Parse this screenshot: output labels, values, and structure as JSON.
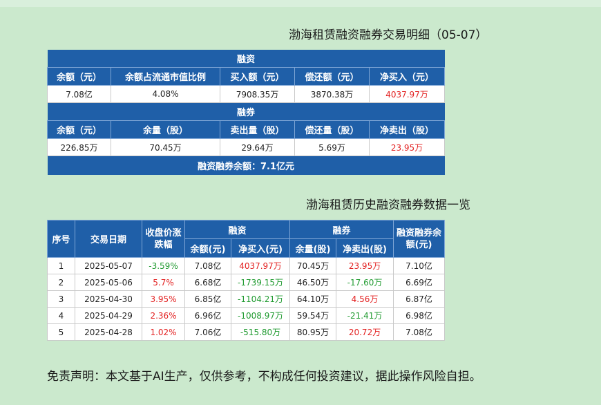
{
  "colors": {
    "header_bg": "#1f5fa8",
    "page_bg": "#cbe9cd",
    "positive": "#e32222",
    "negative": "#1f9a2f"
  },
  "title1": "渤海租赁融资融券交易明细（05-07）",
  "summary": {
    "margin_section": "融资",
    "margin_headers": [
      "余额（元）",
      "余额占流通市值比例",
      "买入额（元）",
      "偿还额（元）",
      "净买入（元）"
    ],
    "margin_values": [
      "7.08亿",
      "4.08%",
      "7908.35万",
      "3870.38万",
      "4037.97万"
    ],
    "short_section": "融券",
    "short_headers": [
      "余额（元）",
      "余量（股）",
      "卖出量（股）",
      "偿还量（股）",
      "净卖出（股）"
    ],
    "short_values": [
      "226.85万",
      "70.45万",
      "29.64万",
      "5.69万",
      "23.95万"
    ],
    "total": "融资融券余额：7.1亿元"
  },
  "title2": "渤海租赁历史融资融券数据一览",
  "history": {
    "headers": {
      "seq": "序号",
      "date": "交易日期",
      "change": "收盘价涨跌幅",
      "margin": "融资",
      "short": "融券",
      "total": "融资融券余额(元)",
      "margin_balance": "余额(元)",
      "net_buy": "净买入(元)",
      "short_volume": "余量(股)",
      "net_sell": "净卖出(股)"
    },
    "rows": [
      {
        "seq": "1",
        "date": "2025-05-07",
        "change": "-3.59%",
        "margin_balance": "7.08亿",
        "net_buy": "4037.97万",
        "short_volume": "70.45万",
        "net_sell": "23.95万",
        "total": "7.10亿"
      },
      {
        "seq": "2",
        "date": "2025-05-06",
        "change": "5.7%",
        "margin_balance": "6.68亿",
        "net_buy": "-1739.15万",
        "short_volume": "46.50万",
        "net_sell": "-17.60万",
        "total": "6.69亿"
      },
      {
        "seq": "3",
        "date": "2025-04-30",
        "change": "3.95%",
        "margin_balance": "6.85亿",
        "net_buy": "-1104.21万",
        "short_volume": "64.10万",
        "net_sell": "4.56万",
        "total": "6.87亿"
      },
      {
        "seq": "4",
        "date": "2025-04-29",
        "change": "2.36%",
        "margin_balance": "6.96亿",
        "net_buy": "-1008.97万",
        "short_volume": "59.54万",
        "net_sell": "-21.41万",
        "total": "6.98亿"
      },
      {
        "seq": "5",
        "date": "2025-04-28",
        "change": "1.02%",
        "margin_balance": "7.06亿",
        "net_buy": "-515.80万",
        "short_volume": "80.95万",
        "net_sell": "20.72万",
        "total": "7.08亿"
      }
    ]
  },
  "disclaimer": "免责声明：本文基于AI生产，仅供参考，不构成任何投资建议，据此操作风险自担。"
}
